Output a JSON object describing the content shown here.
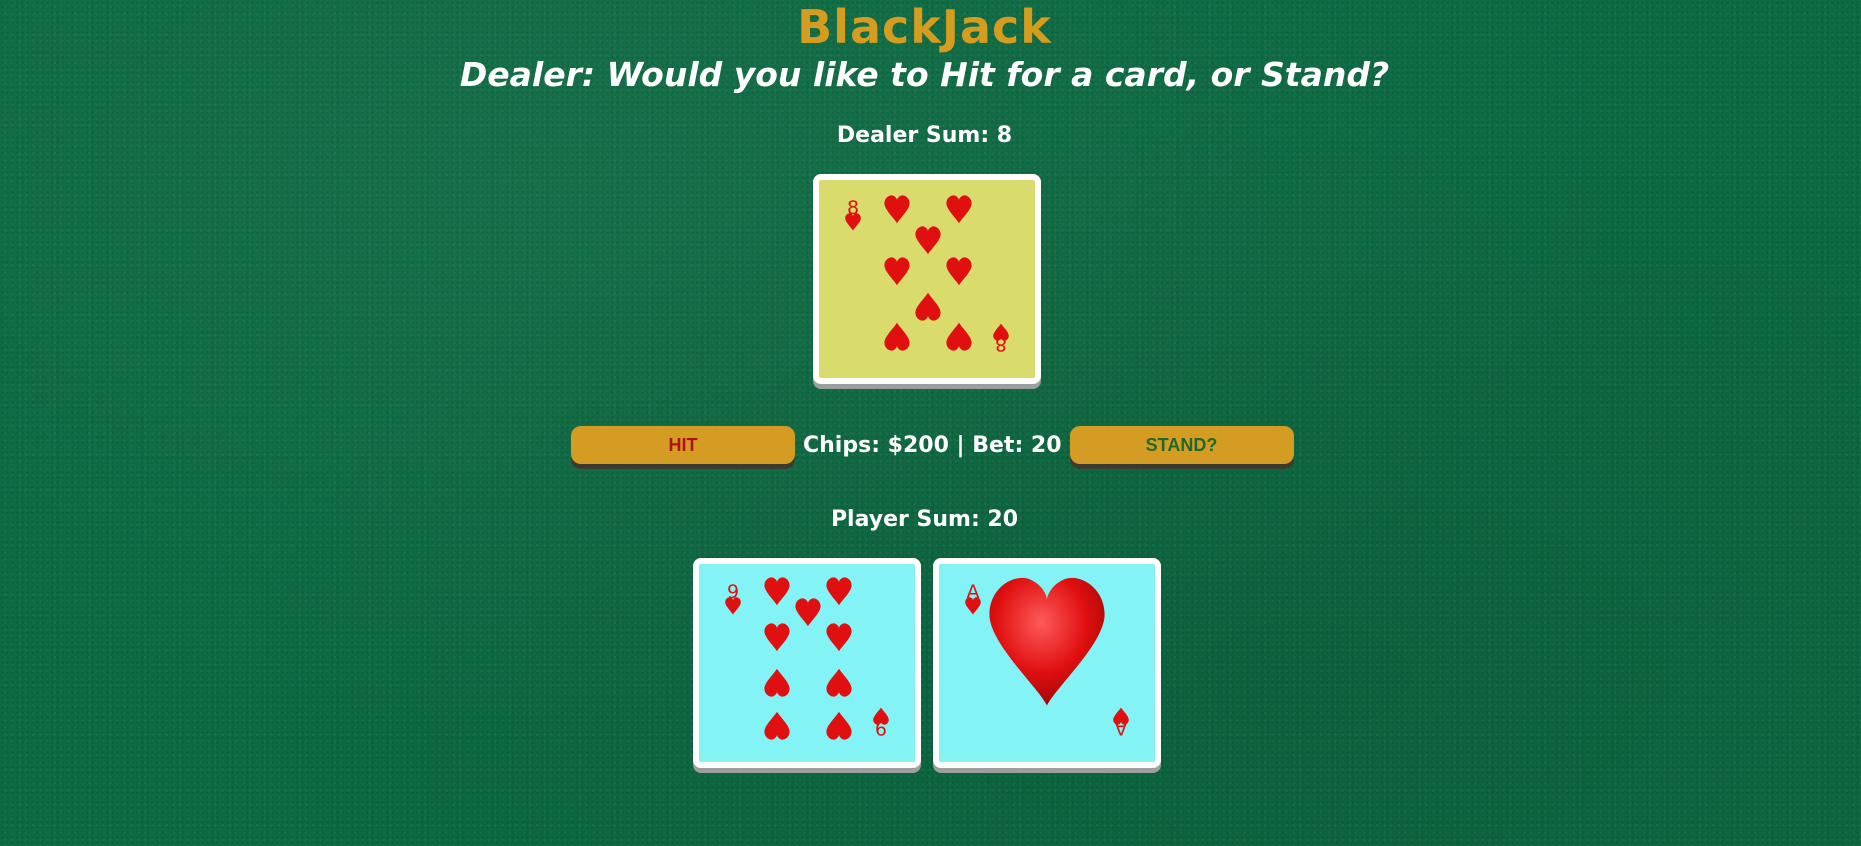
{
  "game": {
    "title": "BlackJack",
    "dealer_message": "Dealer: Would you like to Hit for a card, or Stand?"
  },
  "dealer": {
    "sum_label": "Dealer Sum: 8",
    "cards": [
      {
        "rank": "8",
        "suit": "hearts",
        "face_color": "#d9db6c"
      }
    ]
  },
  "controls": {
    "hit_label": "HIT",
    "stand_label": "STAND?",
    "chips_text": "Chips: $200 | Bet: 20"
  },
  "player": {
    "sum_label": "Player Sum: 20",
    "cards": [
      {
        "rank": "9",
        "suit": "hearts",
        "face_color": "#84f3f6"
      },
      {
        "rank": "A",
        "suit": "hearts",
        "face_color": "#84f3f6"
      }
    ]
  },
  "colors": {
    "felt": "#0d6a42",
    "title_gold": "#d59d1f",
    "button_gold": "#d49c22",
    "hit_text": "#b01010",
    "stand_text": "#1f6a2a",
    "heart_red": "#e01010"
  }
}
